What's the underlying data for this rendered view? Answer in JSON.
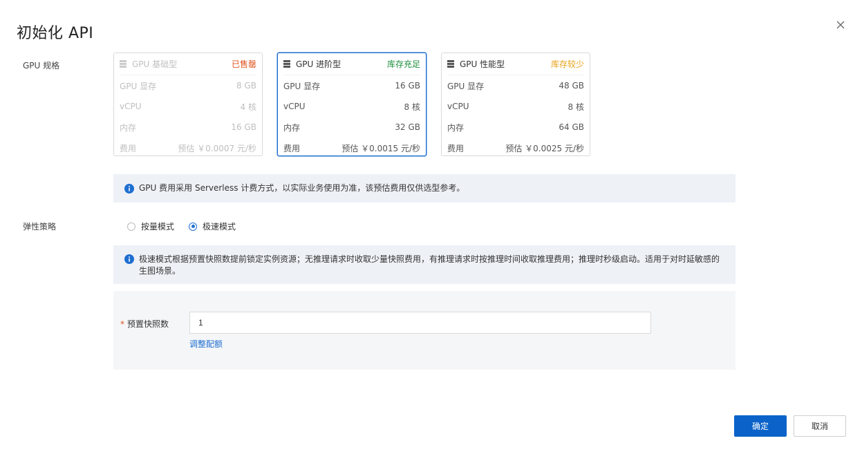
{
  "dialog": {
    "title": "初始化 API"
  },
  "gpu": {
    "label": "GPU 规格",
    "cards": [
      {
        "name": "GPU 基础型",
        "status": "已售罄",
        "status_color": "#e0531f",
        "rows": [
          {
            "label": "GPU 显存",
            "value": "8 GB"
          },
          {
            "label": "vCPU",
            "value": "4 核"
          },
          {
            "label": "内存",
            "value": "16 GB"
          },
          {
            "label": "费用",
            "value": "预估 ￥0.0007 元/秒"
          }
        ]
      },
      {
        "name": "GPU 进阶型",
        "status": "库存充足",
        "status_color": "#1e8e3e",
        "rows": [
          {
            "label": "GPU 显存",
            "value": "16 GB"
          },
          {
            "label": "vCPU",
            "value": "8 核"
          },
          {
            "label": "内存",
            "value": "32 GB"
          },
          {
            "label": "费用",
            "value": "预估 ￥0.0015 元/秒"
          }
        ]
      },
      {
        "name": "GPU 性能型",
        "status": "库存较少",
        "status_color": "#e8a317",
        "rows": [
          {
            "label": "GPU 显存",
            "value": "48 GB"
          },
          {
            "label": "vCPU",
            "value": "8 核"
          },
          {
            "label": "内存",
            "value": "64 GB"
          },
          {
            "label": "费用",
            "value": "预估 ￥0.0025 元/秒"
          }
        ]
      }
    ],
    "notice": "GPU 费用采用 Serverless 计费方式，以实际业务使用为准，该预估费用仅供选型参考。"
  },
  "elastic": {
    "label": "弹性策略",
    "options": [
      "按量模式",
      "极速模式"
    ],
    "selected": "极速模式",
    "notice": "极速模式根据预置快照数提前锁定实例资源；无推理请求时收取少量快照费用，有推理请求时按推理时间收取推理费用；推理时秒级启动。适用于对时延敏感的生图场景。"
  },
  "snapshot": {
    "label": "预置快照数",
    "required_mark": "*",
    "value": "1",
    "link": "调整配额"
  },
  "footer": {
    "confirm": "确定",
    "cancel": "取消"
  },
  "colors": {
    "accent": "#0b63c9",
    "info": "#1f6fd0",
    "notice_bg": "#eef1f6"
  },
  "icons": {
    "close": "close-icon",
    "server": "server-icon",
    "info": "info-icon"
  }
}
